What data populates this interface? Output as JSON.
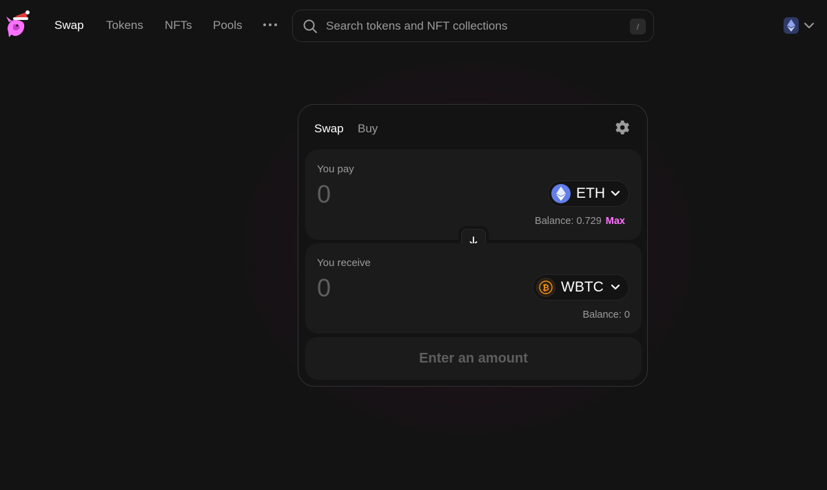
{
  "nav": {
    "links": [
      {
        "label": "Swap",
        "active": true
      },
      {
        "label": "Tokens",
        "active": false
      },
      {
        "label": "NFTs",
        "active": false
      },
      {
        "label": "Pools",
        "active": false
      }
    ],
    "more_icon": "ellipsis-icon",
    "search": {
      "placeholder": "Search tokens and NFT collections",
      "shortcut": "/"
    },
    "network": {
      "icon": "ethereum-icon"
    }
  },
  "swap_card": {
    "tabs": [
      {
        "label": "Swap",
        "active": true
      },
      {
        "label": "Buy",
        "active": false
      }
    ],
    "settings_icon": "gear-icon",
    "pay": {
      "label": "You pay",
      "amount_placeholder": "0",
      "token": "ETH",
      "balance": "Balance: 0.729",
      "max_label": "Max"
    },
    "receive": {
      "label": "You receive",
      "amount_placeholder": "0",
      "token": "WBTC",
      "balance": "Balance: 0"
    },
    "switch_icon": "arrow-down-icon",
    "action_label": "Enter an amount"
  },
  "colors": {
    "background": "#131313",
    "panel": "#1b1b1b",
    "accent_pink": "#fc72ff",
    "eth_blue": "#627eea",
    "btc_orange": "#f7931a",
    "muted_text": "#9b9b9b"
  }
}
